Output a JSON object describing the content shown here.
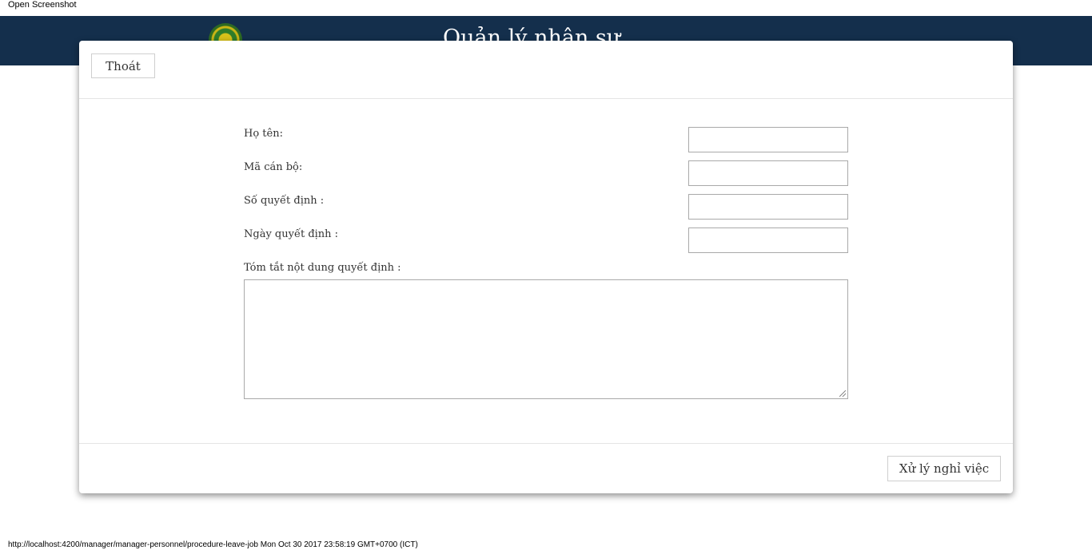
{
  "window": {
    "caption": "Open Screenshot"
  },
  "header": {
    "title": "Quản lý nhân sự",
    "logo_icon": "university-seal-icon"
  },
  "modal": {
    "exit_label": "Thoát",
    "submit_label": "Xử lý nghỉ việc",
    "form": {
      "full_name": {
        "label": "Họ tên:",
        "value": ""
      },
      "staff_code": {
        "label": "Mã cán bộ:",
        "value": ""
      },
      "decision_number": {
        "label": "Số quyết định :",
        "value": ""
      },
      "decision_date": {
        "label": "Ngày quyết định :",
        "value": ""
      },
      "decision_summary": {
        "label": "Tóm tắt nột dung quyết định :",
        "value": ""
      }
    }
  },
  "status_bar": {
    "text": "http://localhost:4200/manager/manager-personnel/procedure-leave-job Mon Oct 30 2017 23:58:19 GMT+0700 (ICT)"
  },
  "colors": {
    "header_bg": "#142f4c",
    "modal_bg": "#ffffff",
    "border": "#cfcfcf"
  }
}
